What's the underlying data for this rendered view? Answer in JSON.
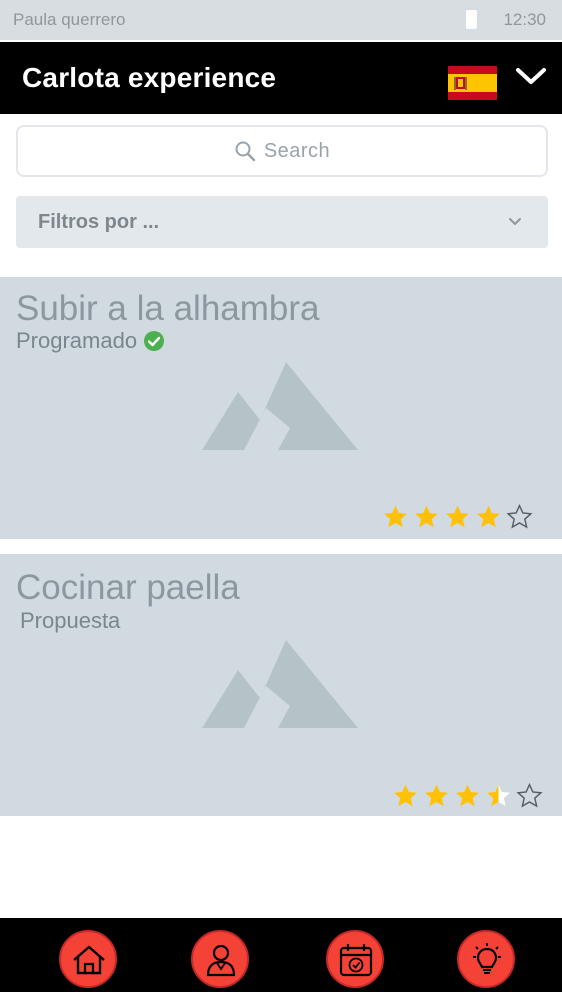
{
  "status_bar": {
    "user": "Paula querrero",
    "time": "12:30"
  },
  "header": {
    "title": "Carlota experience",
    "language_flag": "spain-flag-icon"
  },
  "search": {
    "placeholder": "Search"
  },
  "filter": {
    "label": "Filtros por ..."
  },
  "experiences": [
    {
      "title": "Subir a la alhambra",
      "status": "Programado",
      "status_icon": "check-circle-icon",
      "rating": 4,
      "max_rating": 5
    },
    {
      "title": "Cocinar paella",
      "status": "Propuesta",
      "rating": 3.5,
      "max_rating": 5
    }
  ],
  "bottom_nav": [
    "home-icon",
    "profile-icon",
    "calendar-icon",
    "idea-icon"
  ],
  "colors": {
    "header_bg": "#000000",
    "card_bg": "#d1dae0",
    "star": "#ffc107",
    "nav_button": "#f44336",
    "success": "#4caf50"
  }
}
